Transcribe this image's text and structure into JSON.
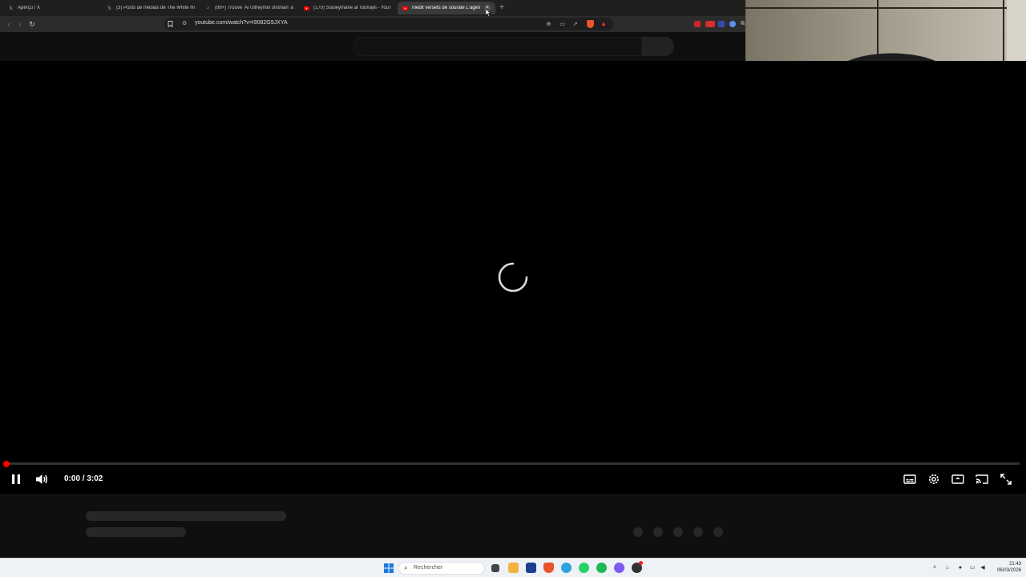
{
  "browser": {
    "tabs": [
      {
        "label": "Aperçu / X",
        "icon": "x-logo-icon",
        "active": false
      },
      {
        "label": "(3) Posts de médias de The White Ho",
        "icon": "x-logo-icon",
        "active": false
      },
      {
        "label": "(99+) Trouve 'Al Utheymin shishan' a",
        "icon": "tiktok-icon",
        "active": false
      },
      {
        "label": "(170) Souleymane ar rouhayli - YouT",
        "icon": "youtube-icon",
        "active": false
      },
      {
        "label": "Inédit versets de sourate L'agen",
        "icon": "youtube-icon",
        "active": true
      }
    ],
    "new_tab_glyph": "+",
    "url": "youtube.com/watch?v=I9082G9JXYA"
  },
  "player": {
    "current_time": "0:00",
    "duration": "3:02",
    "time_text": "0:00 / 3:02",
    "progress_fraction": 0.0,
    "state": "loading"
  },
  "taskbar": {
    "search_placeholder": "Rechercher",
    "time": "21:43",
    "date": "06/03/2026"
  },
  "colors": {
    "youtube_red": "#ff0000",
    "player_bg": "#000000",
    "page_bg": "#0f0f0f",
    "taskbar_bg": "#eef1f6"
  }
}
